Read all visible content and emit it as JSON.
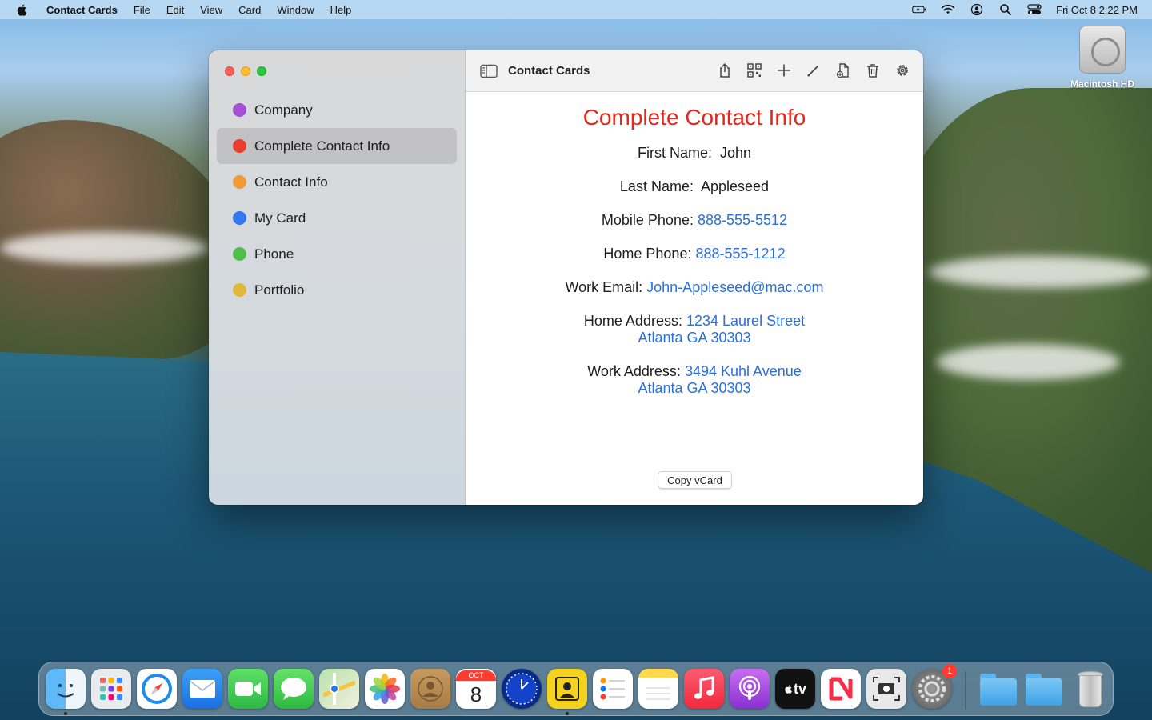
{
  "menubar": {
    "app_name": "Contact Cards",
    "menus": [
      "File",
      "Edit",
      "View",
      "Card",
      "Window",
      "Help"
    ],
    "datetime": "Fri Oct 8  2:22 PM",
    "status_icons": [
      "battery-charging-icon",
      "wifi-icon",
      "user-icon",
      "spotlight-search-icon",
      "control-center-icon"
    ]
  },
  "desktop": {
    "drive_label": "Macintosh HD"
  },
  "window": {
    "toolbar_title": "Contact Cards",
    "toolbar_buttons": [
      "share-icon",
      "qr-code-icon",
      "add-icon",
      "edit-pencil-icon",
      "new-document-icon",
      "trash-icon",
      "settings-gear-icon"
    ]
  },
  "sidebar": {
    "items": [
      {
        "label": "Company",
        "color": "#a64ed8"
      },
      {
        "label": "Complete Contact Info",
        "color": "#ea3d32",
        "selected": true
      },
      {
        "label": "Contact Info",
        "color": "#f19a37"
      },
      {
        "label": "My Card",
        "color": "#3478f1"
      },
      {
        "label": "Phone",
        "color": "#4fbf4c"
      },
      {
        "label": "Portfolio",
        "color": "#dfb93a"
      }
    ]
  },
  "card": {
    "title": "Complete Contact Info",
    "first_name_label": "First Name:",
    "first_name": "John",
    "last_name_label": "Last Name:",
    "last_name": "Appleseed",
    "mobile_label": "Mobile Phone:",
    "mobile": "888-555-5512",
    "home_phone_label": "Home Phone:",
    "home_phone": "888-555-1212",
    "work_email_label": "Work Email:",
    "work_email": "John-Appleseed@mac.com",
    "home_address_label": "Home Address:",
    "home_address_line1": "1234 Laurel Street",
    "home_address_line2": "Atlanta GA 30303",
    "work_address_label": "Work Address:",
    "work_address_line1": "3494 Kuhl Avenue",
    "work_address_line2": "Atlanta GA 30303",
    "copy_button": "Copy vCard"
  },
  "dock": {
    "calendar_month": "OCT",
    "calendar_day": "8",
    "apple_tv_label": "tv",
    "settings_badge": "1",
    "apps": [
      "Finder",
      "Launchpad",
      "Safari",
      "Mail",
      "FaceTime",
      "Messages",
      "Maps",
      "Photos",
      "Contacts",
      "Calendar",
      "Time Tracker",
      "Contact Cards",
      "Reminders",
      "Notes",
      "Music",
      "Podcasts",
      "TV",
      "News",
      "Screenshot",
      "System Preferences"
    ]
  }
}
